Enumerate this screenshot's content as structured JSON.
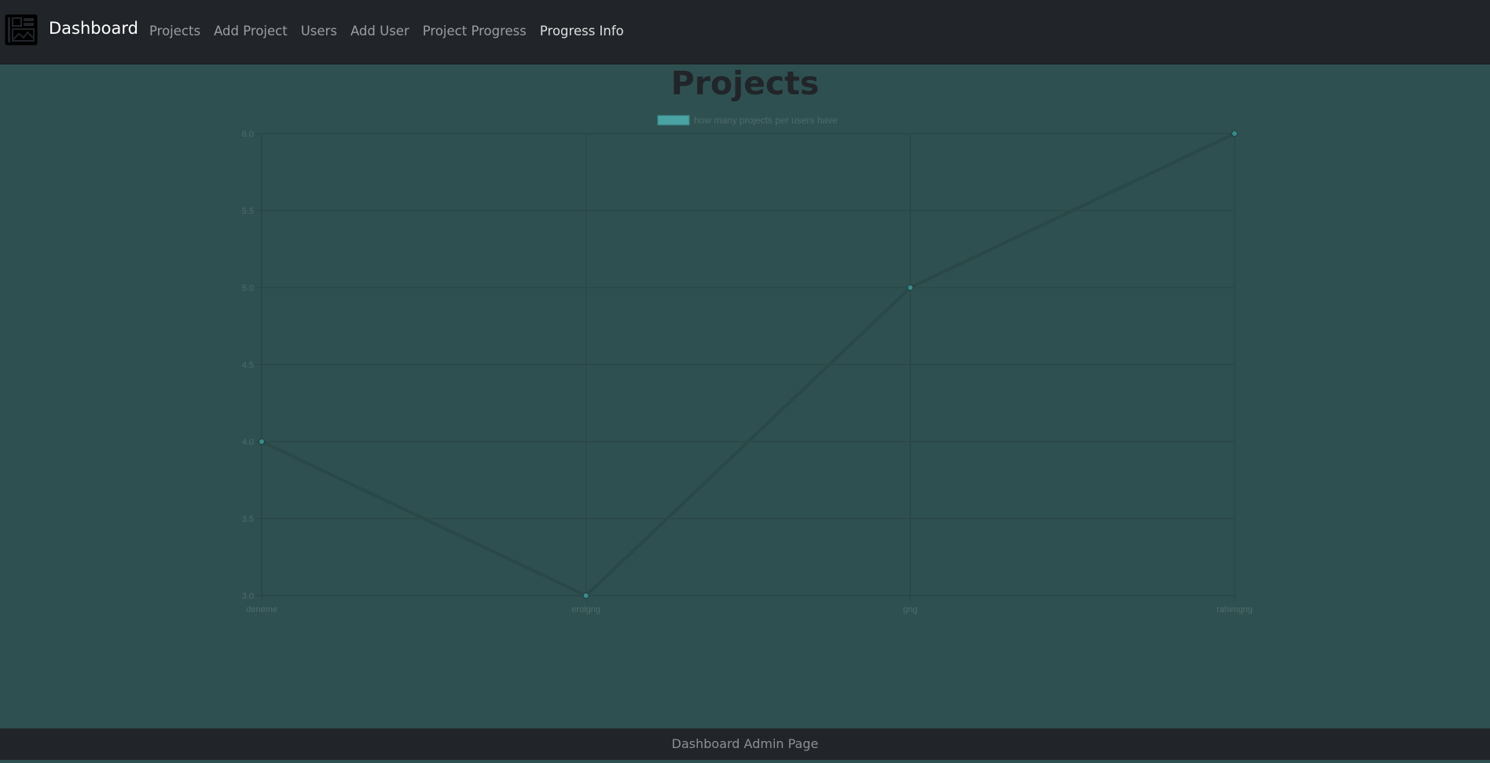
{
  "navbar": {
    "brand": "Dashboard",
    "logo_icon": "dashboard-logo-icon",
    "links": [
      {
        "label": "Projects",
        "active": false
      },
      {
        "label": "Add Project",
        "active": false
      },
      {
        "label": "Users",
        "active": false
      },
      {
        "label": "Add User",
        "active": false
      },
      {
        "label": "Project Progress",
        "active": false
      },
      {
        "label": "Progress Info",
        "active": true
      }
    ]
  },
  "main": {
    "title": "Projects"
  },
  "chart_data": {
    "type": "line",
    "categories": [
      "deneme",
      "erolgng",
      "gng",
      "rahimgng"
    ],
    "series": [
      {
        "name": "how many projects per users have",
        "values": [
          4,
          3,
          5,
          6
        ]
      }
    ],
    "ylim": [
      3.0,
      6.0
    ],
    "yticks": [
      "6.0",
      "5.5",
      "5.0",
      "4.5",
      "4.0",
      "3.5",
      "3.0"
    ],
    "grid": true,
    "legend": "top-center",
    "colors": {
      "line": "#2a4848",
      "point": "#3a8c8c",
      "legend_box": "#4aa3a3",
      "grid": "#2a4545",
      "tick": "#4f6b6b"
    }
  },
  "footer": {
    "text": "Dashboard Admin Page"
  }
}
